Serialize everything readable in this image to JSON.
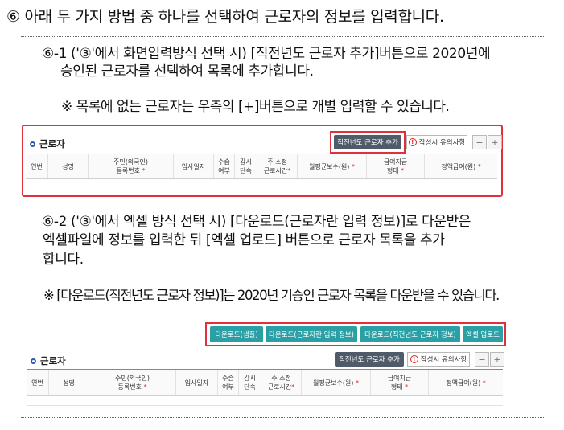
{
  "heading": "⑥ 아래 두 가지 방법 중 하나를 선택하여 근로자의 정보를 입력합니다.",
  "step1": {
    "line1": "⑥-1 ('③'에서 화면입력방식 선택 시) [직전년도 근로자 추가]버튼으로 2020년에",
    "line2": "승인된 근로자를 선택하여 목록에 추가합니다.",
    "note": "※ 목록에 없는 근로자는 우측의 [+]버튼으로 개별 입력할 수 있습니다."
  },
  "step2": {
    "line1": "⑥-2 ('③'에서 엑셀 방식 선택 시) [다운로드(근로자란 입력 정보)]로 다운받은",
    "line2": "엑셀파일에 정보를 입력한 뒤 [엑셀 업로드] 버튼으로 근로자 목록을 추가",
    "line3": "합니다.",
    "note": "※ [다운로드(직전년도 근로자 정보)]는 2020년 기승인 근로자 목록을 다운받을 수 있습니다."
  },
  "panel": {
    "section_title": "근로자",
    "add_prev_year_button": "직전년도 근로자 추가",
    "caution_button": "작성시 유의사항",
    "minus": "−",
    "plus": "+",
    "required_mark": "*"
  },
  "download_buttons": {
    "sample": "다운로드(샘플)",
    "input_info": "다운로드(근로자란 입력 정보)",
    "prev_year_info": "다운로드(직전년도 근로자 정보)",
    "excel_upload": "엑셀 업로드"
  },
  "columns": {
    "no": "연번",
    "name": "성명",
    "rrn_line1": "주민(외국인)",
    "rrn_line2": "등록번호",
    "hire_date": "입사일자",
    "recv_line1": "수습",
    "recv_line2": "여부",
    "reduce_line1": "감시",
    "reduce_line2": "단속",
    "hours_line1": "주 소정",
    "hours_line2": "근로시간",
    "avg_pay": "월평균보수(원)",
    "pay_type_line1": "급여지급",
    "pay_type_line2": "형태",
    "fixed_pay": "정액급여(원)"
  },
  "colors": {
    "highlight_red": "#e0303c",
    "dark_button": "#4f5b69",
    "teal_button": "#2aa0a6",
    "section_dot": "#2a5caa"
  }
}
